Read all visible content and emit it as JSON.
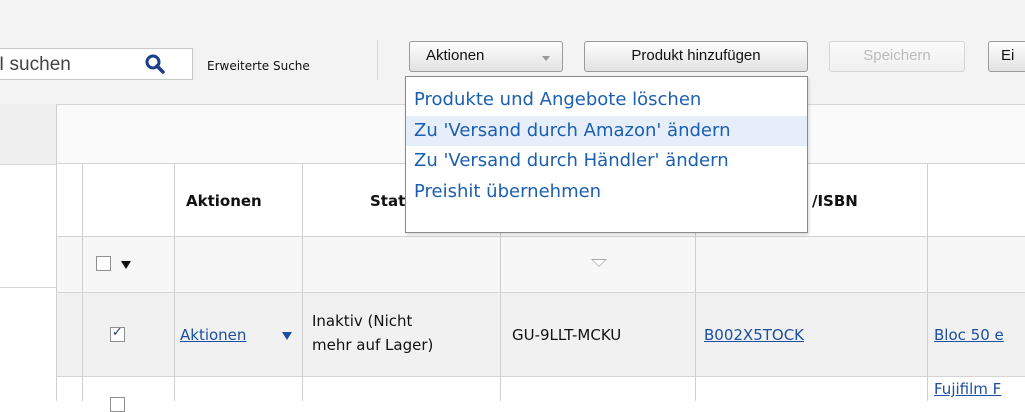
{
  "toolbar": {
    "search_text": "I suchen",
    "advanced_search": "Erweiterte Suche",
    "actions_label": "Aktionen",
    "add_product_label": "Produkt hinzufügen",
    "save_label": "Speichern",
    "more_label": "Ei"
  },
  "dropdown": {
    "items": [
      {
        "label": "Produkte und Angebote löschen"
      },
      {
        "label": "Zu 'Versand durch Amazon' ändern"
      },
      {
        "label": "Zu 'Versand durch Händler' ändern"
      },
      {
        "label": "Preishit übernehmen"
      }
    ]
  },
  "table": {
    "headers": {
      "actions": "Aktionen",
      "status": "Stat",
      "asin": "/ISBN"
    },
    "rows": [
      {
        "checked": true,
        "actions": "Aktionen",
        "status_line1": "Inaktiv (Nicht",
        "status_line2": "mehr auf Lager)",
        "sku": "GU-9LLT-MCKU",
        "asin": "B002X5TOCK",
        "title": "Bloc 50 e"
      },
      {
        "checked": false,
        "title": "Fujifilm F"
      }
    ]
  },
  "colors": {
    "link": "#1b4fa0",
    "dropdown_link": "#1b5fb0",
    "highlight": "#e6eef9"
  }
}
